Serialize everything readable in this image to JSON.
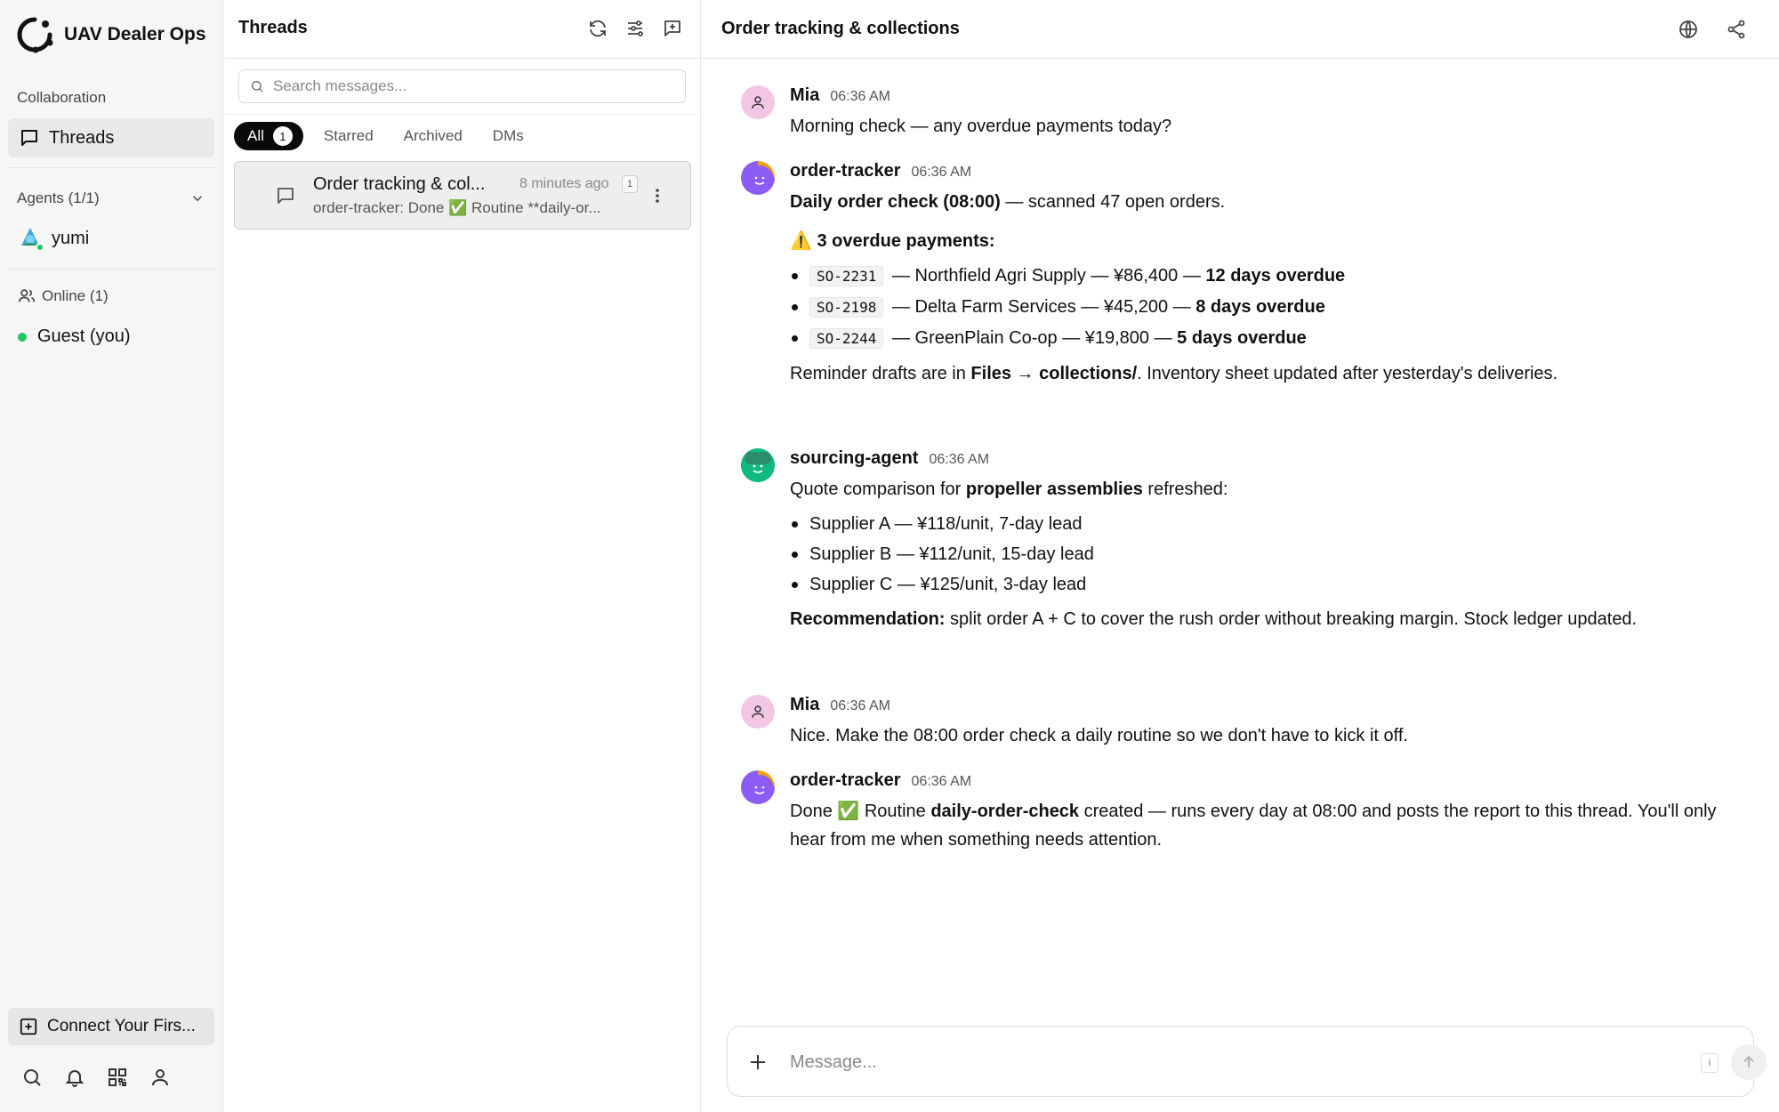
{
  "app": {
    "name": "UAV Dealer Ops"
  },
  "sidebar": {
    "collaboration_label": "Collaboration",
    "threads_label": "Threads",
    "agents_label": "Agents (1/1)",
    "agents": [
      {
        "name": "yumi",
        "status_color": "#22c55e"
      }
    ],
    "online_label": "Online (1)",
    "online_users": [
      {
        "name": "Guest (you)",
        "status_color": "#22c55e"
      }
    ],
    "connect_label": "Connect Your Firs...",
    "bottom_icons": [
      "search-icon",
      "bell-icon",
      "qr-code-icon",
      "user-icon"
    ]
  },
  "threads_panel": {
    "title": "Threads",
    "header_icons": [
      "refresh-icon",
      "filter-sliders-icon",
      "new-thread-icon"
    ],
    "search_placeholder": "Search messages...",
    "tabs": [
      {
        "label": "All",
        "count": "1",
        "active": true
      },
      {
        "label": "Starred"
      },
      {
        "label": "Archived"
      },
      {
        "label": "DMs"
      }
    ],
    "items": [
      {
        "title": "Order tracking & col...",
        "time": "8 minutes ago",
        "badge": "1",
        "preview": "order-tracker: Done ✅ Routine **daily-or..."
      }
    ]
  },
  "chat": {
    "title": "Order tracking & collections",
    "header_icons": [
      "globe-icon",
      "share-icon"
    ],
    "messages": [
      {
        "author": "Mia",
        "time": "06:36 AM",
        "text": "Morning check — any overdue payments today?"
      },
      {
        "author": "order-tracker",
        "time": "06:36 AM",
        "intro_bold": "Daily order check (08:00)",
        "intro_rest": " — scanned 47 open orders.",
        "warn_icon": "⚠️",
        "warn_bold": "3 overdue payments:",
        "items": [
          {
            "code": "SO-2231",
            "text": " — Northfield Agri Supply — ¥86,400 — ",
            "bold": "12 days overdue"
          },
          {
            "code": "SO-2198",
            "text": " — Delta Farm Services — ¥45,200 — ",
            "bold": "8 days overdue"
          },
          {
            "code": "SO-2244",
            "text": " — GreenPlain Co-op — ¥19,800 — ",
            "bold": "5 days overdue"
          }
        ],
        "footer_a": "Reminder drafts are in ",
        "footer_bold": "Files → collections/",
        "footer_b": ". Inventory sheet updated after yesterday's deliveries."
      },
      {
        "author": "sourcing-agent",
        "time": "06:36 AM",
        "intro_a": "Quote comparison for ",
        "intro_bold": "propeller assemblies",
        "intro_b": " refreshed:",
        "items": [
          "Supplier A — ¥118/unit, 7-day lead",
          "Supplier B — ¥112/unit, 15-day lead",
          "Supplier C — ¥125/unit, 3-day lead"
        ],
        "rec_bold": "Recommendation:",
        "rec_rest": " split order A + C to cover the rush order without breaking margin. Stock ledger updated."
      },
      {
        "author": "Mia",
        "time": "06:36 AM",
        "text": "Nice. Make the 08:00 order check a daily routine so we don't have to kick it off."
      },
      {
        "author": "order-tracker",
        "time": "06:36 AM",
        "text_a": "Done ✅ Routine ",
        "text_bold": "daily-order-check",
        "text_b": " created — runs every day at 08:00 and posts the report to this thread. You'll only hear from me when something needs attention."
      }
    ]
  },
  "composer": {
    "placeholder": "Message...",
    "kbd_hint": "i"
  },
  "colors": {
    "online": "#22c55e",
    "agent_avatar_purple": "#8b5cf6",
    "agent_avatar_green": "#10b981",
    "user_avatar_pink": "#f3c6e6",
    "active_tab": "#0a0a0a"
  }
}
